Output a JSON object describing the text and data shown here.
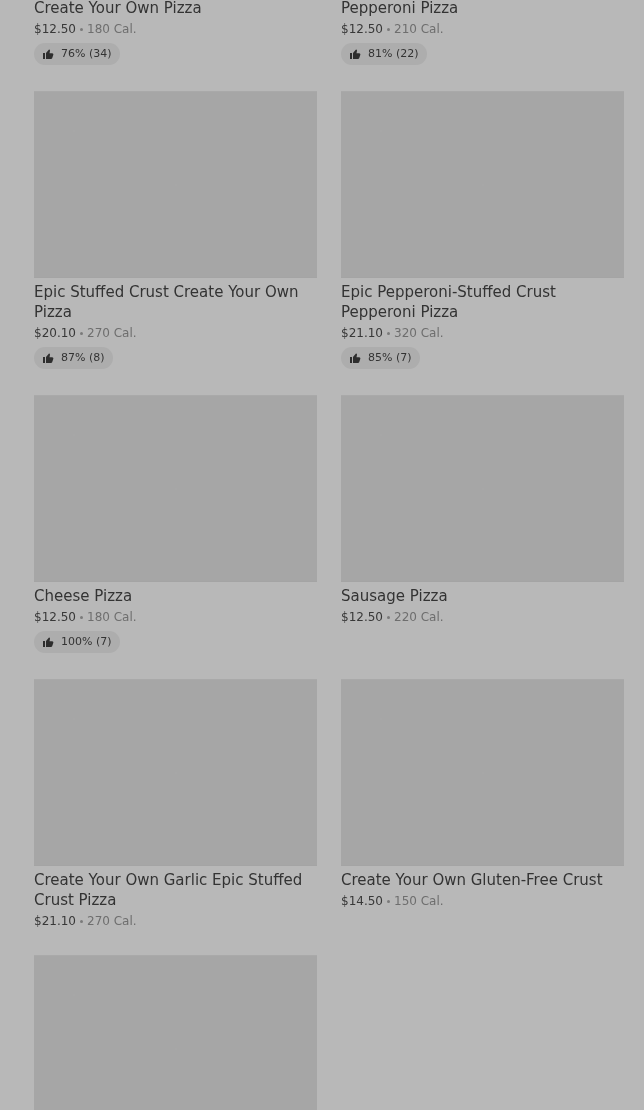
{
  "items": [
    {
      "title": "Create Your Own Pizza",
      "price": "$12.50",
      "calories": "180 Cal.",
      "rating": "76% (34)"
    },
    {
      "title": "Pepperoni Pizza",
      "price": "$12.50",
      "calories": "210 Cal.",
      "rating": "81% (22)"
    },
    {
      "image": {
        "kind": "picture"
      },
      "title": "Epic Stuffed Crust Create Your Own Pizza",
      "price": "$20.10",
      "calories": "270 Cal.",
      "rating": "87% (8)"
    },
    {
      "image": {
        "kind": "picture"
      },
      "title": "Epic Pepperoni-Stuffed Crust Pepperoni Pizza",
      "price": "$21.10",
      "calories": "320 Cal.",
      "rating": "85% (7)"
    },
    {
      "image": {
        "kind": "picture"
      },
      "title": "Cheese Pizza",
      "price": "$12.50",
      "calories": "180 Cal.",
      "rating": "100% (7)"
    },
    {
      "image": {
        "kind": "picture"
      },
      "title": "Sausage Pizza",
      "price": "$12.50",
      "calories": "220 Cal."
    },
    {
      "image": {
        "kind": "picture"
      },
      "title": "Create Your Own Garlic Epic Stuffed Crust Pizza",
      "price": "$21.10",
      "calories": "270 Cal."
    },
    {
      "image": {
        "kind": "picture"
      },
      "title": "Create Your Own Gluten-Free Crust",
      "price": "$14.50",
      "calories": "150 Cal."
    },
    {
      "image": {
        "kind": "picture"
      }
    }
  ]
}
